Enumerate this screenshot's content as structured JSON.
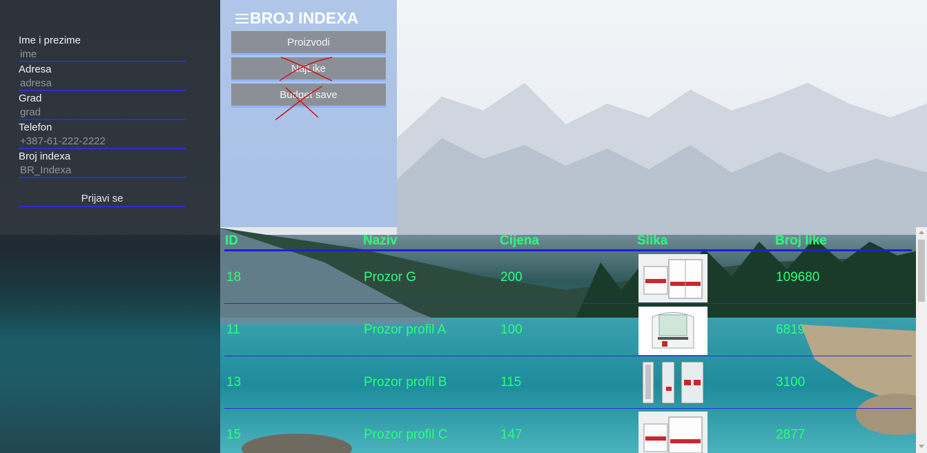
{
  "sidebar": {
    "fields": [
      {
        "label": "Ime i prezime",
        "placeholder": "ime"
      },
      {
        "label": "Adresa",
        "placeholder": "adresa"
      },
      {
        "label": "Grad",
        "placeholder": "grad"
      },
      {
        "label": "Telefon",
        "placeholder": "+387-61-222-2222"
      },
      {
        "label": "Broj indexa",
        "placeholder": "BR_Indexa"
      }
    ],
    "login_label": "Prijavi se"
  },
  "menu": {
    "brand": "BROJ INDEXA",
    "brand_icon": "hamburger-icon",
    "items": [
      {
        "label": "Proizvodi",
        "crossed": false
      },
      {
        "label": "NajLike",
        "crossed": true
      },
      {
        "label": "Budget save",
        "crossed": true
      }
    ]
  },
  "table": {
    "headers": [
      "ID",
      "Naziv",
      "Cijena",
      "Slika",
      "Broj like"
    ],
    "rows": [
      {
        "id": "18",
        "naziv": "Prozor G",
        "cijena": "200",
        "slika": "window-profile-image",
        "likes": "109680"
      },
      {
        "id": "11",
        "naziv": "Prozor profil A",
        "cijena": "100",
        "slika": "window-profile-image",
        "likes": "6819"
      },
      {
        "id": "13",
        "naziv": "Prozor profil B",
        "cijena": "115",
        "slika": "window-profile-image",
        "likes": "3100"
      },
      {
        "id": "15",
        "naziv": "Prozor profil C",
        "cijena": "147",
        "slika": "window-profile-image",
        "likes": "2877"
      }
    ]
  },
  "colors": {
    "table_text": "#2bff7a",
    "underline": "#2b2fcf",
    "strike": "#d0121c"
  }
}
